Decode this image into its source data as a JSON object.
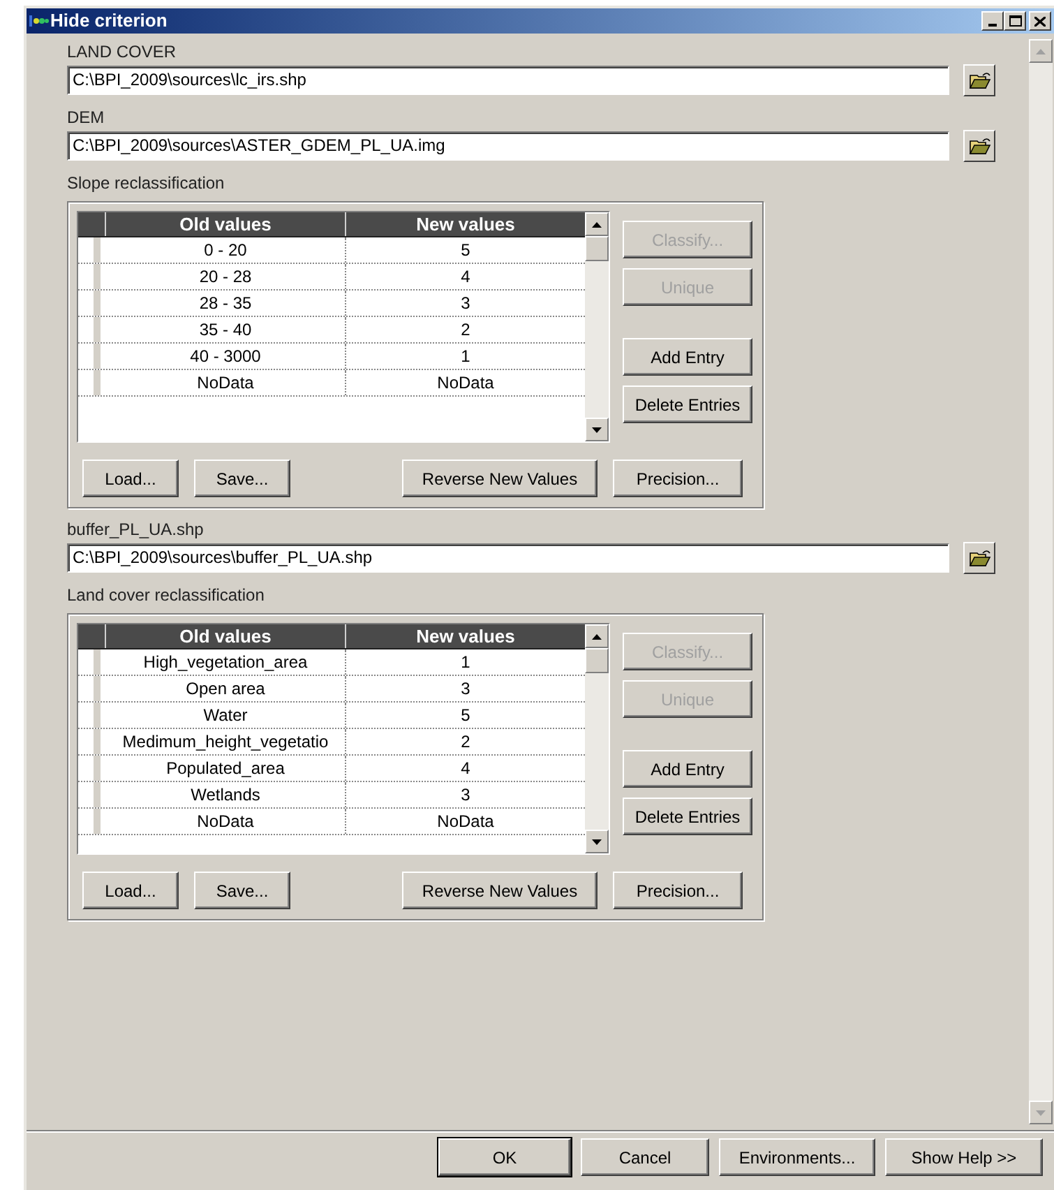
{
  "window": {
    "title": "Hide criterion"
  },
  "sections": [
    {
      "kind": "file",
      "label": "LAND COVER",
      "value": "C:\\BPI_2009\\sources\\lc_irs.shp"
    },
    {
      "kind": "file",
      "label": "DEM",
      "value": "C:\\BPI_2009\\sources\\ASTER_GDEM_PL_UA.img"
    },
    {
      "kind": "reclass",
      "label": "Slope reclassification",
      "columns": [
        "Old values",
        "New values"
      ],
      "rows": [
        [
          "0 - 20",
          "5"
        ],
        [
          "20 - 28",
          "4"
        ],
        [
          "28 - 35",
          "3"
        ],
        [
          "35 - 40",
          "2"
        ],
        [
          "40 - 3000",
          "1"
        ],
        [
          "NoData",
          "NoData"
        ]
      ],
      "side_buttons": [
        {
          "label": "Classify...",
          "disabled": true
        },
        {
          "label": "Unique",
          "disabled": true
        },
        {
          "label": "Add Entry",
          "disabled": false
        },
        {
          "label": "Delete Entries",
          "disabled": false
        }
      ],
      "bottom_buttons": [
        "Load...",
        "Save...",
        "Reverse New Values",
        "Precision..."
      ]
    },
    {
      "kind": "file",
      "label": "buffer_PL_UA.shp",
      "value": "C:\\BPI_2009\\sources\\buffer_PL_UA.shp"
    },
    {
      "kind": "reclass",
      "label": "Land cover reclassification",
      "columns": [
        "Old values",
        "New values"
      ],
      "rows": [
        [
          "High_vegetation_area",
          "1"
        ],
        [
          "Open area",
          "3"
        ],
        [
          "Water",
          "5"
        ],
        [
          "Medimum_height_vegetatio",
          "2"
        ],
        [
          "Populated_area",
          "4"
        ],
        [
          "Wetlands",
          "3"
        ],
        [
          "NoData",
          "NoData"
        ]
      ],
      "side_buttons": [
        {
          "label": "Classify...",
          "disabled": true
        },
        {
          "label": "Unique",
          "disabled": true
        },
        {
          "label": "Add Entry",
          "disabled": false
        },
        {
          "label": "Delete Entries",
          "disabled": false
        }
      ],
      "bottom_buttons": [
        "Load...",
        "Save...",
        "Reverse New Values",
        "Precision..."
      ]
    }
  ],
  "footer_buttons": [
    {
      "label": "OK",
      "default": true
    },
    {
      "label": "Cancel",
      "default": false
    },
    {
      "label": "Environments...",
      "default": false
    },
    {
      "label": "Show Help >>",
      "default": false
    }
  ]
}
